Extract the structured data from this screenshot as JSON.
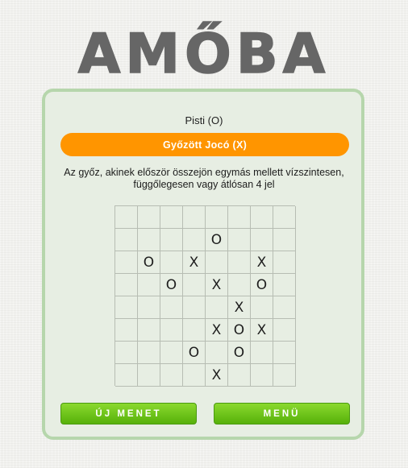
{
  "logo_text": "AMŐBA",
  "player_label": "Pisti (O)",
  "status": "Győzött Jocó (X)",
  "rules_line1": "Az győz, akinek először összejön egymás mellett vízszintesen,",
  "rules_line2": "függőlegesen vagy átlósan 4 jel",
  "board": [
    [
      "",
      "",
      "",
      "",
      "",
      "",
      "",
      ""
    ],
    [
      "",
      "",
      "",
      "",
      "O",
      "",
      "",
      ""
    ],
    [
      "",
      "O",
      "",
      "X",
      "",
      "",
      "X",
      ""
    ],
    [
      "",
      "",
      "O",
      "",
      "X",
      "",
      "O",
      ""
    ],
    [
      "",
      "",
      "",
      "",
      "",
      "X",
      "",
      ""
    ],
    [
      "",
      "",
      "",
      "",
      "X",
      "O",
      "X",
      ""
    ],
    [
      "",
      "",
      "",
      "O",
      "",
      "O",
      "",
      ""
    ],
    [
      "",
      "",
      "",
      "",
      "X",
      "",
      "",
      ""
    ]
  ],
  "buttons": {
    "new_round": "ÚJ MENET",
    "menu": "MENÜ"
  },
  "colors": {
    "status_bar": "#ff9500",
    "button_green": "#6cc41a",
    "panel_border": "#b6d6ac",
    "logo": "#666666"
  }
}
